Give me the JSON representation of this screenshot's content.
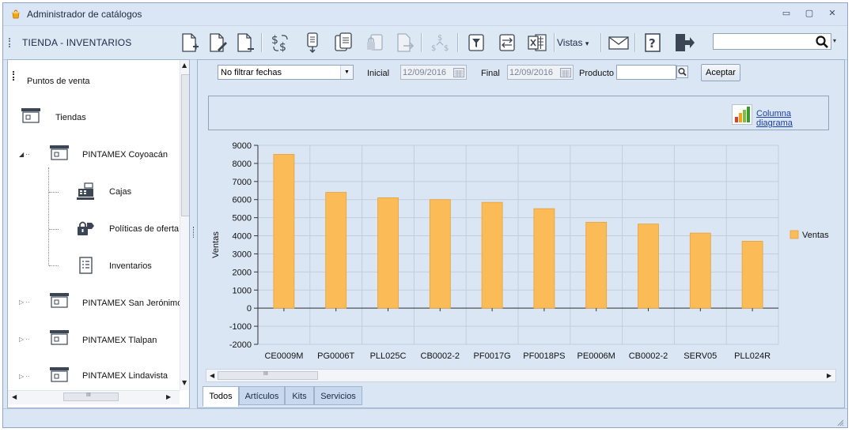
{
  "window": {
    "title": "Administrador de catálogos",
    "controls": {
      "minimize": "▭",
      "maximize": "▢",
      "close": "✕"
    }
  },
  "toolbar": {
    "module_title": "TIENDA - INVENTARIOS",
    "vistas_label": "Vistas",
    "vistas_arrow": "▾",
    "buttons": [
      "new-document-icon",
      "edit-document-icon",
      "delete-document-icon",
      "price-change-icon",
      "download-file-icon",
      "clipboard-copy-icon",
      "lock-document-icon",
      "document-arrow-icon",
      "price-flow-icon",
      "filter-icon",
      "export-icon",
      "excel-icon",
      "mail-icon",
      "help-icon",
      "exit-icon"
    ],
    "search_value": "",
    "search_drop": "▾"
  },
  "tree": {
    "root": "Puntos de venta",
    "group": "Tiendas",
    "stores": [
      {
        "label": "PINTAMEX Coyoacán",
        "expanded": true
      },
      {
        "label": "PINTAMEX San Jerónimo",
        "expanded": false
      },
      {
        "label": "PINTAMEX Tlalpan",
        "expanded": false
      },
      {
        "label": "PINTAMEX Lindavista",
        "expanded": false
      }
    ],
    "children": [
      "Cajas",
      "Políticas de oferta",
      "Inventarios"
    ],
    "hscroll_grip": "III"
  },
  "filters": {
    "date_filter": "No filtrar fechas",
    "inicial_label": "Inicial",
    "inicial_value": "12/09/2016",
    "final_label": "Final",
    "final_value": "12/09/2016",
    "producto_label": "Producto",
    "producto_value": "",
    "aceptar": "Aceptar"
  },
  "chart_panel": {
    "link": "Columna diagrama"
  },
  "chart_data": {
    "type": "bar",
    "categories": [
      "CE0009M",
      "PG0006T",
      "PLL025C",
      "CB0002-2",
      "PF0017G",
      "PF0018PS",
      "PE0006M",
      "CB0002-2",
      "SERV05",
      "PLL024R"
    ],
    "series": [
      {
        "name": "Ventas",
        "values": [
          8500,
          6400,
          6100,
          6000,
          5850,
          5500,
          4750,
          4650,
          4150,
          3700
        ],
        "color": "#fbbc57"
      }
    ],
    "ylabel": "Ventas",
    "ylim": [
      -2000,
      9000
    ],
    "yticks": [
      -2000,
      -1000,
      0,
      1000,
      2000,
      3000,
      4000,
      5000,
      6000,
      7000,
      8000,
      9000
    ],
    "grid": true,
    "legend": "right"
  },
  "chart_scroll": {
    "grip": "III"
  },
  "tabs": [
    {
      "label": "Todos",
      "active": true
    },
    {
      "label": "Artículos",
      "active": false
    },
    {
      "label": "Kits",
      "active": false
    },
    {
      "label": "Servicios",
      "active": false
    }
  ]
}
